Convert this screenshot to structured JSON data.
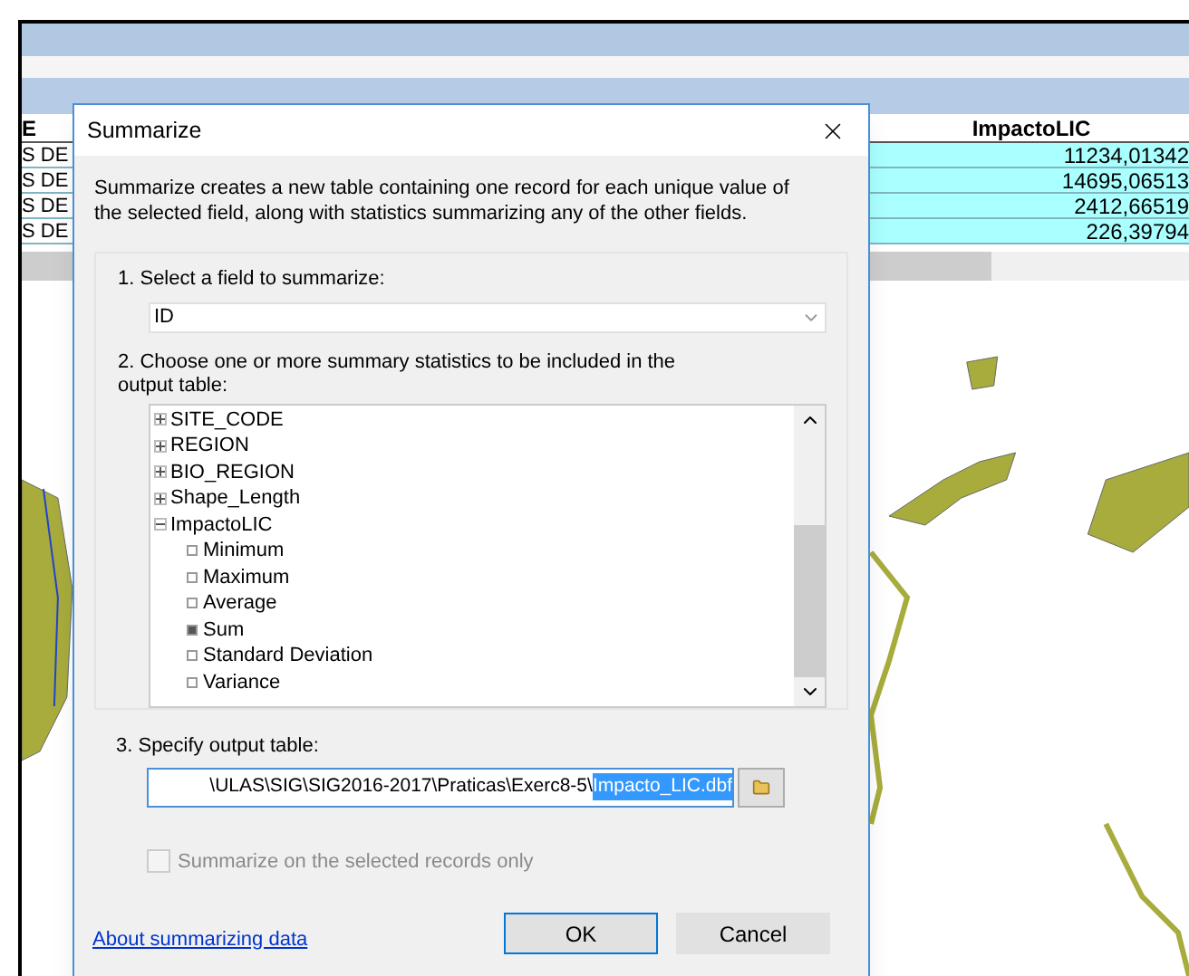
{
  "table": {
    "columns": [
      "E",
      "ImpactoLIC"
    ],
    "rows": [
      [
        "S DE",
        "11234,01342"
      ],
      [
        "S DE",
        "14695,06513"
      ],
      [
        "S DE",
        "2412,66519"
      ],
      [
        "S DE",
        "226,39794"
      ]
    ]
  },
  "dialog": {
    "title": "Summarize",
    "description": "Summarize creates a new table containing one record for each unique value of the selected field, along with statistics summarizing any of the other fields.",
    "step1": {
      "label": "1.  Select a field to summarize:",
      "value": "ID"
    },
    "step2": {
      "label": "2.  Choose one or more summary statistics to be included in the output table:",
      "tree": [
        {
          "label": "SITE_CODE",
          "expanded": false
        },
        {
          "label": "REGION",
          "expanded": false
        },
        {
          "label": "BIO_REGION",
          "expanded": false
        },
        {
          "label": "Shape_Length",
          "expanded": false
        },
        {
          "label": "ImpactoLIC",
          "expanded": true,
          "children": [
            {
              "label": "Minimum",
              "checked": false
            },
            {
              "label": "Maximum",
              "checked": false
            },
            {
              "label": "Average",
              "checked": false
            },
            {
              "label": "Sum",
              "checked": true
            },
            {
              "label": "Standard Deviation",
              "checked": false
            },
            {
              "label": "Variance",
              "checked": false
            }
          ]
        }
      ]
    },
    "step3": {
      "label": "3.  Specify output table:",
      "path": "\\ULAS\\SIG\\SIG2016-2017\\Praticas\\Exerc8-5\\",
      "selected_text": "Impacto_LIC.dbf"
    },
    "selected_only": {
      "label": "Summarize on the selected records only",
      "checked": false,
      "disabled": true
    },
    "help_link": "About summarizing data",
    "buttons": [
      {
        "label": "OK",
        "default": true
      },
      {
        "label": "Cancel",
        "default": false
      }
    ]
  }
}
